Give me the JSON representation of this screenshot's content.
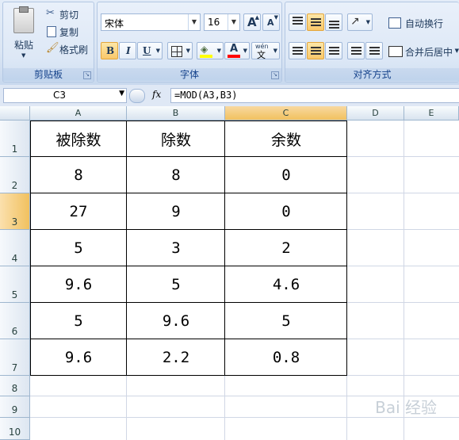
{
  "ribbon": {
    "clipboard": {
      "paste": "粘贴",
      "cut": "剪切",
      "copy": "复制",
      "format_painter": "格式刷",
      "label": "剪贴板"
    },
    "font": {
      "family": "宋体",
      "size": "16",
      "bold": "B",
      "italic": "I",
      "underline": "U",
      "grow": "A",
      "shrink": "A",
      "wen": "wén",
      "label": "字体"
    },
    "alignment": {
      "wrap_text": "自动换行",
      "merge_center": "合并后居中",
      "label": "对齐方式"
    }
  },
  "formula_bar": {
    "name_box": "C3",
    "fx": "fx",
    "formula": "=MOD(A3,B3)"
  },
  "sheet": {
    "columns": [
      "A",
      "B",
      "C",
      "D",
      "E"
    ],
    "rows": [
      "1",
      "2",
      "3",
      "4",
      "5",
      "6",
      "7",
      "8",
      "9",
      "10"
    ],
    "header": [
      "被除数",
      "除数",
      "余数"
    ],
    "data": [
      [
        "8",
        "8",
        "0"
      ],
      [
        "27",
        "9",
        "0"
      ],
      [
        "5",
        "3",
        "2"
      ],
      [
        "9.6",
        "5",
        "4.6"
      ],
      [
        "5",
        "9.6",
        "5"
      ],
      [
        "9.6",
        "2.2",
        "0.8"
      ]
    ]
  },
  "watermark": "Bai 经验"
}
